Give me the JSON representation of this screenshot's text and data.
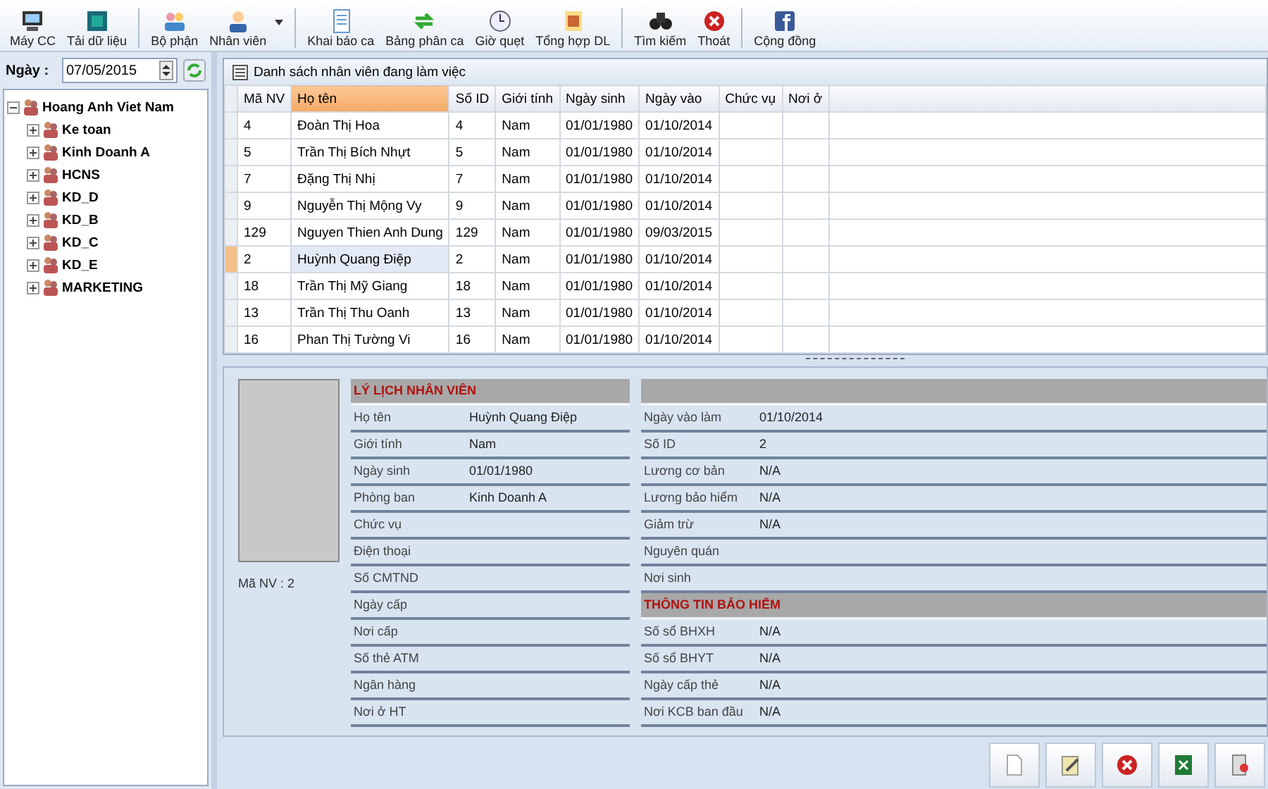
{
  "toolbar": [
    {
      "label": "Máy CC",
      "dropdown": false
    },
    {
      "label": "Tải dữ liệu",
      "dropdown": false
    },
    {
      "label": "Bộ phận",
      "dropdown": false
    },
    {
      "label": "Nhân viên",
      "dropdown": true
    },
    {
      "label": "Khai báo ca",
      "dropdown": false
    },
    {
      "label": "Bảng phân ca",
      "dropdown": false
    },
    {
      "label": "Giờ quẹt",
      "dropdown": false
    },
    {
      "label": "Tổng hợp DL",
      "dropdown": false
    },
    {
      "label": "Tìm kiếm",
      "dropdown": false
    },
    {
      "label": "Thoát",
      "dropdown": false
    },
    {
      "label": "Cộng đồng",
      "dropdown": false
    }
  ],
  "date": {
    "label": "Ngày :",
    "value": "07/05/2015"
  },
  "tree": {
    "label": "Hoang Anh Viet Nam",
    "expanded": true,
    "children": [
      {
        "label": "Ke toan",
        "expanded": false
      },
      {
        "label": "Kinh Doanh A",
        "expanded": false
      },
      {
        "label": "HCNS",
        "expanded": false
      },
      {
        "label": "KD_D",
        "expanded": false
      },
      {
        "label": "KD_B",
        "expanded": false
      },
      {
        "label": "KD_C",
        "expanded": false
      },
      {
        "label": "KD_E",
        "expanded": false
      },
      {
        "label": "MARKETING",
        "expanded": false
      }
    ]
  },
  "grid": {
    "title": "Danh sách nhân viên đang làm việc",
    "columns": [
      {
        "label": "Mã NV",
        "selected": false
      },
      {
        "label": "Họ tên",
        "selected": true
      },
      {
        "label": "Số ID",
        "selected": false
      },
      {
        "label": "Giới tính",
        "selected": false
      },
      {
        "label": "Ngày sinh",
        "selected": false
      },
      {
        "label": "Ngày vào",
        "selected": false
      },
      {
        "label": "Chức vụ",
        "selected": false
      },
      {
        "label": "Nơi ở",
        "selected": false
      }
    ],
    "rows": [
      {
        "cells": [
          "4",
          "Đoàn Thị Hoa",
          "4",
          "Nam",
          "01/01/1980",
          "01/10/2014",
          "",
          ""
        ],
        "selected": false
      },
      {
        "cells": [
          "5",
          "Trần Thị Bích Nhựt",
          "5",
          "Nam",
          "01/01/1980",
          "01/10/2014",
          "",
          ""
        ],
        "selected": false
      },
      {
        "cells": [
          "7",
          "Đặng Thị Nhị",
          "7",
          "Nam",
          "01/01/1980",
          "01/10/2014",
          "",
          ""
        ],
        "selected": false
      },
      {
        "cells": [
          "9",
          "Nguyễn Thị Mộng Vy",
          "9",
          "Nam",
          "01/01/1980",
          "01/10/2014",
          "",
          ""
        ],
        "selected": false
      },
      {
        "cells": [
          "129",
          "Nguyen Thien Anh Dung",
          "129",
          "Nam",
          "01/01/1980",
          "09/03/2015",
          "",
          ""
        ],
        "selected": false
      },
      {
        "cells": [
          "2",
          "Huỳnh Quang Điệp",
          "2",
          "Nam",
          "01/01/1980",
          "01/10/2014",
          "",
          ""
        ],
        "selected": true
      },
      {
        "cells": [
          "18",
          "Trần Thị Mỹ Giang",
          "18",
          "Nam",
          "01/01/1980",
          "01/10/2014",
          "",
          ""
        ],
        "selected": false
      },
      {
        "cells": [
          "13",
          "Trần Thị Thu Oanh",
          "13",
          "Nam",
          "01/01/1980",
          "01/10/2014",
          "",
          ""
        ],
        "selected": false
      },
      {
        "cells": [
          "16",
          "Phan Thị Tường Vi",
          "16",
          "Nam",
          "01/01/1980",
          "01/10/2014",
          "",
          ""
        ],
        "selected": false
      }
    ]
  },
  "profile": {
    "employee_id": "Mã NV :  2",
    "left": [
      {
        "kind": "header",
        "title": "LÝ LỊCH NHÂN VIÊN"
      },
      {
        "kind": "field",
        "label": "Họ tên",
        "value": "Huỳnh Quang Điệp"
      },
      {
        "kind": "field",
        "label": "Giới tính",
        "value": "Nam"
      },
      {
        "kind": "field",
        "label": "Ngày sinh",
        "value": "01/01/1980"
      },
      {
        "kind": "field",
        "label": "Phòng ban",
        "value": "Kinh Doanh A"
      },
      {
        "kind": "field",
        "label": "Chức vụ"
      },
      {
        "kind": "field",
        "label": "Điện thoại"
      },
      {
        "kind": "field",
        "label": "Số CMTND"
      },
      {
        "kind": "field",
        "label": "Ngày cấp"
      },
      {
        "kind": "field",
        "label": "Nơi cấp"
      },
      {
        "kind": "field",
        "label": "Số thẻ ATM"
      },
      {
        "kind": "field",
        "label": "Ngân hàng"
      },
      {
        "kind": "field",
        "label": "Nơi ở HT"
      }
    ],
    "right": [
      {
        "kind": "header"
      },
      {
        "kind": "field",
        "label": "Ngày vào làm",
        "value": "01/10/2014"
      },
      {
        "kind": "field",
        "label": "Số ID",
        "value": "2"
      },
      {
        "kind": "field",
        "label": "Lương cơ bản",
        "value": "N/A"
      },
      {
        "kind": "field",
        "label": "Lương bảo hiểm",
        "value": "N/A"
      },
      {
        "kind": "field",
        "label": "Giảm trừ",
        "value": "N/A"
      },
      {
        "kind": "field",
        "label": "Nguyên quán"
      },
      {
        "kind": "field",
        "label": "Nơi sinh"
      },
      {
        "kind": "header",
        "title": "THÔNG TIN BẢO HIỂM"
      },
      {
        "kind": "field",
        "label": "Số sổ BHXH",
        "value": "N/A"
      },
      {
        "kind": "field",
        "label": "Số sổ BHYT",
        "value": "N/A"
      },
      {
        "kind": "field",
        "label": "Ngày cấp thẻ",
        "value": "N/A"
      },
      {
        "kind": "field",
        "label": "Nơi KCB ban đầu",
        "value": "N/A"
      }
    ]
  }
}
